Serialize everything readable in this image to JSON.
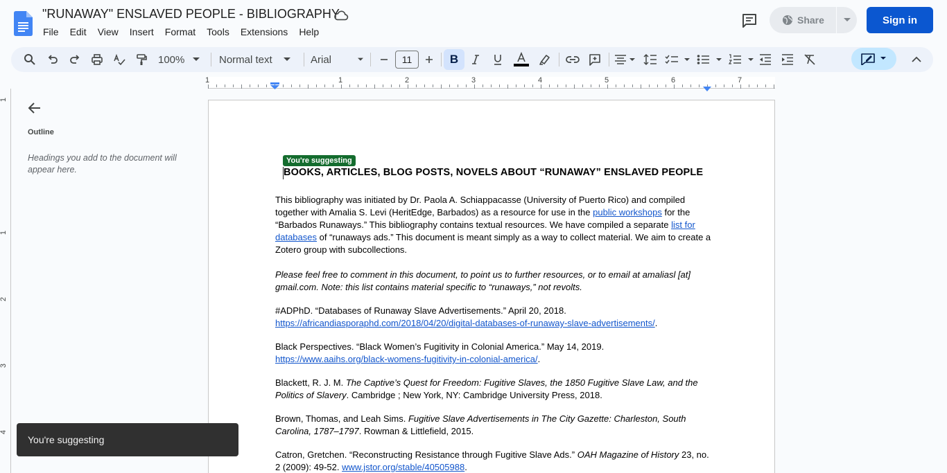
{
  "app": {
    "title": "\"RUNAWAY\" ENSLAVED PEOPLE - BIBLIOGRAPHY",
    "menu": [
      "File",
      "Edit",
      "View",
      "Insert",
      "Format",
      "Tools",
      "Extensions",
      "Help"
    ],
    "share_label": "Share",
    "signin_label": "Sign in"
  },
  "toolbar": {
    "zoom": "100%",
    "style": "Normal text",
    "font": "Arial",
    "font_size": "11",
    "bold_label": "B",
    "text_color": "#000000"
  },
  "ruler": {
    "h_labels": [
      "1",
      "1",
      "2",
      "3",
      "4",
      "5",
      "6",
      "7"
    ],
    "v_labels": [
      "1",
      "1",
      "2",
      "3",
      "4"
    ]
  },
  "outline": {
    "title": "Outline",
    "empty_text": "Headings you add to the document will appear here."
  },
  "doc": {
    "suggest_tag": "You're suggesting",
    "heading": "BOOKS, ARTICLES, BLOG POSTS, NOVELS ABOUT “RUNAWAY” ENSLAVED PEOPLE",
    "intro": {
      "t1": "This bibliography was initiated by Dr. Paola A. Schiappacasse (University of Puerto Rico) and compiled together with Amalia S. Levi (HeritEdge, Barbados) as a resource for use in the ",
      "link1": "public workshops",
      "t2": " for the “Barbados Runaways.” This bibliography contains textual resources. We have compiled a separate ",
      "link2": "list for databases",
      "t3": " of “runaways ads.” This document is meant simply as a way to collect material. We aim to create a Zotero group with subcollections."
    },
    "note": "Please feel free to comment in this document, to point us to further resources, or to email at amaliasl [at] gmail.com. Note: this list contains material specific to “runaways,” not revolts.",
    "entries": [
      {
        "text": "#ADPhD. “Databases of Runaway Slave Advertisements.” April 20, 2018.",
        "url": "https://africandiasporaphd.com/2018/04/20/digital-databases-of-runaway-slave-advertisements/",
        "end": "."
      },
      {
        "text": "Black Perspectives. “Black Women’s Fugitivity in Colonial America.” May 14, 2019.",
        "url": "https://www.aaihs.org/black-womens-fugitivity-in-colonial-america/",
        "end": "."
      },
      {
        "pre": "Blackett, R. J. M. ",
        "title": "The Captive’s Quest for Freedom: Fugitive Slaves, the 1850 Fugitive Slave Law, and the Politics of Slavery",
        "post": ". Cambridge ; New York, NY: Cambridge University Press, 2018."
      },
      {
        "pre": "Brown, Thomas, and Leah Sims. ",
        "title": "Fugitive Slave Advertisements in The City Gazette: Charleston, South Carolina, 1787–1797",
        "post": ". Rowman & Littlefield, 2015."
      },
      {
        "pre": "Catron, Gretchen. “Reconstructing Resistance through Fugitive Slave Ads.” ",
        "title": "OAH Magazine of History",
        "post": " 23, no. 2 (2009): 49-52. ",
        "url": "www.jstor.org/stable/40505988",
        "end": "."
      }
    ]
  },
  "snackbar": {
    "text": "You're suggesting"
  }
}
